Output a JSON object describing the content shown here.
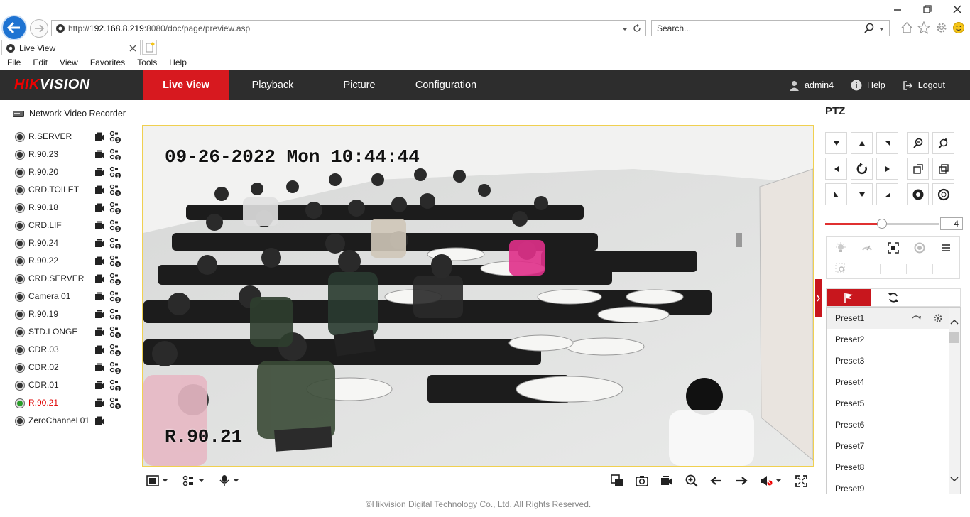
{
  "browser": {
    "url_prefix": "http://",
    "url_host": "192.168.8.219",
    "url_rest": ":8080/doc/page/preview.asp",
    "search_placeholder": "Search...",
    "tab_title": "Live View",
    "menu": [
      "File",
      "Edit",
      "View",
      "Favorites",
      "Tools",
      "Help"
    ]
  },
  "app": {
    "brand_red": "HIK",
    "brand_white": "VISION",
    "nav_tabs": [
      "Live View",
      "Playback",
      "Picture",
      "Configuration"
    ],
    "active_tab": "Live View",
    "user": "admin4",
    "help": "Help",
    "logout": "Logout"
  },
  "sidebar": {
    "device": "Network Video Recorder",
    "channels": [
      {
        "name": "R.SERVER"
      },
      {
        "name": "R.90.23"
      },
      {
        "name": "R.90.20"
      },
      {
        "name": "CRD.TOILET"
      },
      {
        "name": "R.90.18"
      },
      {
        "name": "CRD.LIF"
      },
      {
        "name": "R.90.24"
      },
      {
        "name": "R.90.22"
      },
      {
        "name": "CRD.SERVER"
      },
      {
        "name": "Camera 01"
      },
      {
        "name": "R.90.19"
      },
      {
        "name": "STD.LONGE"
      },
      {
        "name": "CDR.03"
      },
      {
        "name": "CDR.02"
      },
      {
        "name": "CDR.01"
      },
      {
        "name": "R.90.21",
        "active": true
      },
      {
        "name": "ZeroChannel 01"
      }
    ]
  },
  "video": {
    "osd_timestamp": "09-26-2022 Mon 10:44:44",
    "osd_channel": "R.90.21",
    "selection_color": "#f0d050"
  },
  "ptz": {
    "title": "PTZ",
    "speed": "4",
    "speed_level": 0.5,
    "presets": [
      "Preset1",
      "Preset2",
      "Preset3",
      "Preset4",
      "Preset5",
      "Preset6",
      "Preset7",
      "Preset8",
      "Preset9"
    ]
  },
  "footer": "©Hikvision Digital Technology Co., Ltd. All Rights Reserved.",
  "colors": {
    "accent": "#d7191f",
    "nav_bg": "#2d2d2d"
  }
}
